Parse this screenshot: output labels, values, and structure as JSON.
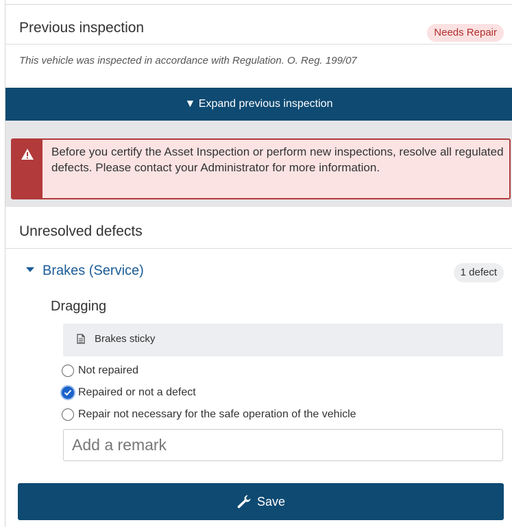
{
  "inspection": {
    "title": "Previous inspection",
    "status_badge": "Needs Repair",
    "regulation_text": "This vehicle was inspected in accordance with Regulation. O. Reg. 199/07",
    "expand_label": "▼ Expand previous inspection"
  },
  "alert": {
    "icon": "warning-triangle-icon",
    "message": "Before you certify the Asset Inspection or perform new inspections, resolve all regulated defects. Please contact your Administrator for more information."
  },
  "defects": {
    "section_title": "Unresolved defects",
    "groups": [
      {
        "name": "Brakes (Service)",
        "count_label": "1 defect",
        "items": [
          {
            "name": "Dragging",
            "note": "Brakes sticky",
            "options": [
              {
                "label": "Not repaired",
                "checked": false
              },
              {
                "label": "Repaired or not a defect",
                "checked": true
              },
              {
                "label": "Repair not necessary for the safe operation of the vehicle",
                "checked": false
              }
            ],
            "remark_placeholder": "Add a remark"
          }
        ]
      }
    ]
  },
  "actions": {
    "save_label": "Save",
    "save_icon": "wrench-icon"
  },
  "colors": {
    "primary": "#0e4a72",
    "link": "#1c5c97",
    "danger": "#b23a3a",
    "danger_bg": "#fbe3e3",
    "radio_checked": "#1a62c8"
  }
}
